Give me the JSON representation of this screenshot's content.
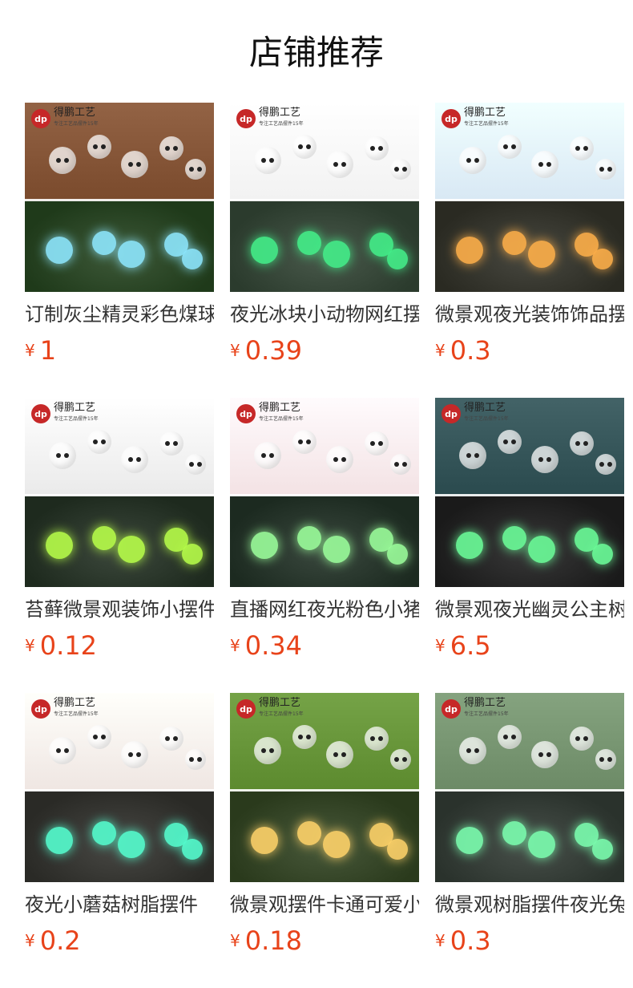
{
  "page_title": "店铺推荐",
  "brand": {
    "logo_mark": "dp",
    "logo_name": "得鹏工艺",
    "logo_sub": "专注工艺品摆件15年"
  },
  "currency": "¥",
  "products": [
    {
      "title": "订制灰尘精灵彩色煤球",
      "price": "1",
      "top_bg": "#7a4a2c",
      "bottom_bg": "#1f3a1a",
      "glow": "#8ee8ff"
    },
    {
      "title": "夜光冰块小动物网红摆件",
      "price": "0.39",
      "top_bg": "#f2f2f2",
      "bottom_bg": "#2b3b2d",
      "glow": "#44f08a"
    },
    {
      "title": "微景观夜光装饰饰品摆件",
      "price": "0.3",
      "top_bg": "#d8e8f4",
      "bottom_bg": "#2a2a22",
      "glow": "#ffb04a"
    },
    {
      "title": "苔藓微景观装饰小摆件",
      "price": "0.12",
      "top_bg": "#eaeaea",
      "bottom_bg": "#1e2a1e",
      "glow": "#b8ff4a"
    },
    {
      "title": "直播网红夜光粉色小猪",
      "price": "0.34",
      "top_bg": "#f3e2e4",
      "bottom_bg": "#1c2a20",
      "glow": "#9cff9c"
    },
    {
      "title": "微景观夜光幽灵公主树精",
      "price": "6.5",
      "top_bg": "#2a4a4e",
      "bottom_bg": "#1a1a1a",
      "glow": "#6cff9a"
    },
    {
      "title": "夜光小蘑菇树脂摆件",
      "price": "0.2",
      "top_bg": "#efe6e2",
      "bottom_bg": "#2a2a26",
      "glow": "#55ffd0"
    },
    {
      "title": "微景观摆件卡通可爱小鸭",
      "price": "0.18",
      "top_bg": "#5c8a2e",
      "bottom_bg": "#2a3a1c",
      "glow": "#ffd36a"
    },
    {
      "title": "微景观树脂摆件夜光兔子",
      "price": "0.3",
      "top_bg": "#6c8a66",
      "bottom_bg": "#2a322c",
      "glow": "#7cffb0"
    }
  ]
}
